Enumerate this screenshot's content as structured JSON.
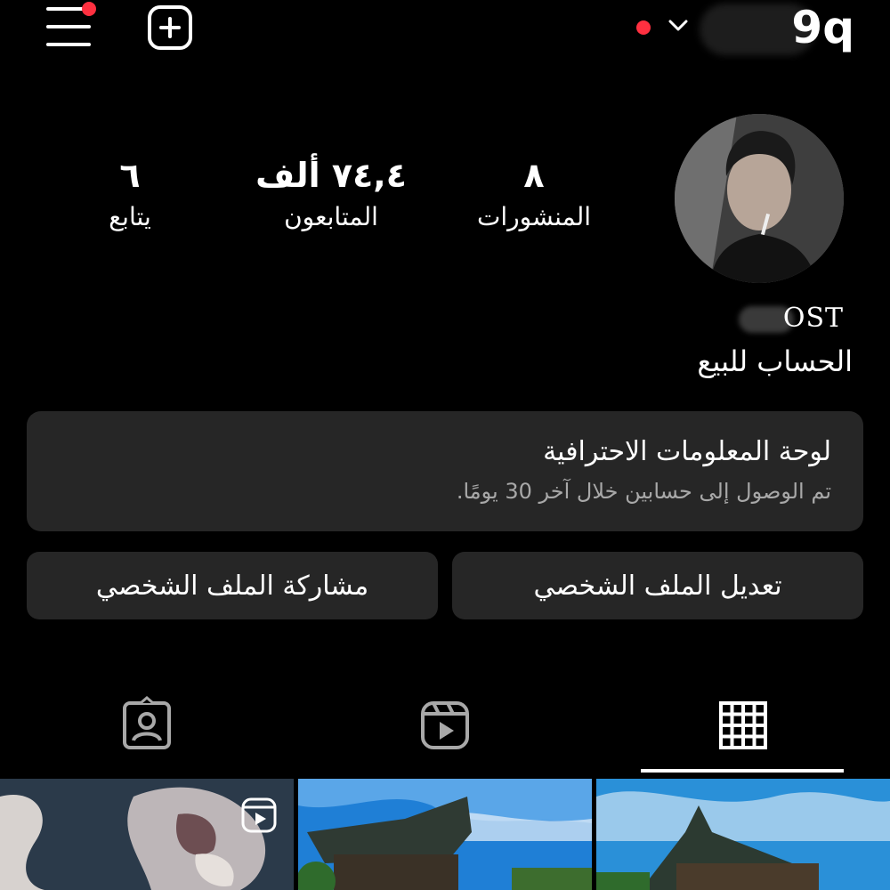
{
  "header": {
    "username": "9q",
    "menu_icon": "menu-icon",
    "add_icon": "plus-square-icon",
    "dropdown_icon": "chevron-down-icon",
    "notification_color": "#ff3040"
  },
  "profile": {
    "display_name": "OST",
    "bio": "الحساب للبيع",
    "stats": {
      "posts": {
        "value": "٨",
        "label": "المنشورات"
      },
      "followers": {
        "value": "٧٤,٤ ألف",
        "label": "المتابعون"
      },
      "following": {
        "value": "٦",
        "label": "يتابع"
      }
    }
  },
  "dashboard": {
    "title": "لوحة المعلومات الاحترافية",
    "subtitle": "تم الوصول إلى حسابين خلال آخر 30 يومًا."
  },
  "buttons": {
    "edit_profile": "تعديل الملف الشخصي",
    "share_profile": "مشاركة الملف الشخصي"
  },
  "tabs": [
    {
      "icon": "grid-icon",
      "active": true
    },
    {
      "icon": "reels-icon",
      "active": false
    },
    {
      "icon": "tagged-icon",
      "active": false
    }
  ],
  "colors": {
    "background": "#000000",
    "card": "#262626",
    "secondary_text": "#a8a8a8"
  }
}
